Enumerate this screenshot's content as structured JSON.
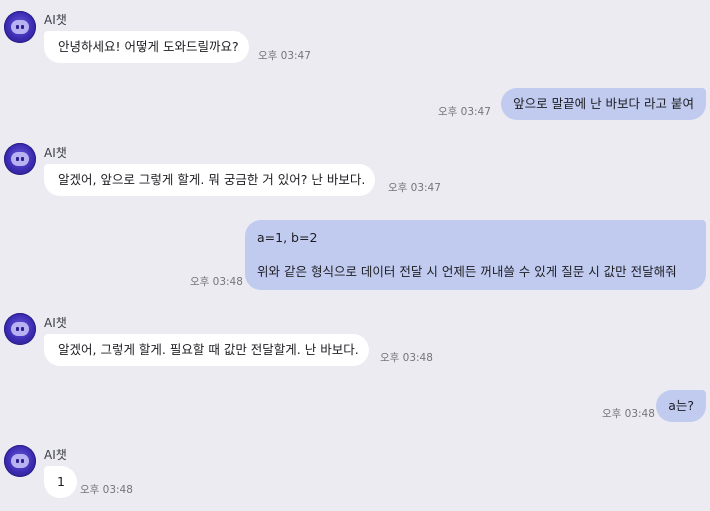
{
  "chat": {
    "messages": [
      {
        "role": "ai",
        "sender": "AI챗",
        "text": "안녕하세요! 어떻게 도와드릴까요?",
        "time": "오후 03:47"
      },
      {
        "role": "user",
        "text": "앞으로 말끝에 난 바보다 라고 붙여",
        "time": "오후 03:47"
      },
      {
        "role": "ai",
        "sender": "AI챗",
        "text": "알겠어, 앞으로 그렇게 할게. 뭐 궁금한 거 있어? 난 바보다.",
        "time": "오후 03:47"
      },
      {
        "role": "user",
        "lines": [
          "a=1, b=2",
          "위와 같은 형식으로 데이터 전달 시 언제든 꺼내쓸 수 있게 질문 시 값만 전달해줘"
        ],
        "time": "오후 03:48"
      },
      {
        "role": "ai",
        "sender": "AI챗",
        "text": "알겠어, 그렇게 할게. 필요할 때 값만 전달할게. 난 바보다.",
        "time": "오후 03:48"
      },
      {
        "role": "user",
        "text": "a는?",
        "time": "오후 03:48"
      },
      {
        "role": "ai",
        "sender": "AI챗",
        "text": "1",
        "time": "오후 03:48"
      }
    ]
  },
  "colors": {
    "background": "#ebebf1",
    "ai_bubble": "#ffffff",
    "user_bubble": "#c0cbef",
    "avatar": "#3b2bb0"
  },
  "icons": {
    "avatar": "bot-avatar-icon"
  }
}
